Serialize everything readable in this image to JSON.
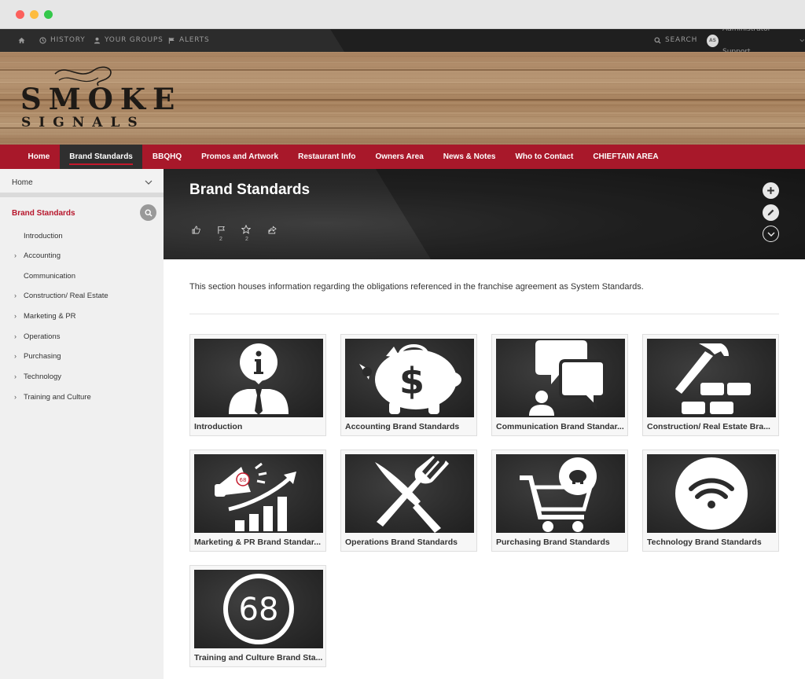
{
  "topbar": {
    "history": "HISTORY",
    "your_groups": "YOUR GROUPS",
    "alerts": "ALERTS",
    "search": "SEARCH",
    "avatar_initials": "AS",
    "user_name": "Administrator Support"
  },
  "logo": {
    "line1": "SMOKE",
    "line2": "SIGNALS"
  },
  "mainnav": [
    {
      "label": "Home"
    },
    {
      "label": "Brand Standards",
      "active": true
    },
    {
      "label": "BBQHQ"
    },
    {
      "label": "Promos and Artwork"
    },
    {
      "label": "Restaurant Info"
    },
    {
      "label": "Owners Area"
    },
    {
      "label": "News & Notes"
    },
    {
      "label": "Who to Contact"
    },
    {
      "label": "CHIEFTAIN AREA"
    }
  ],
  "sidebar": {
    "home": "Home",
    "section": "Brand Standards",
    "items": [
      {
        "label": "Introduction",
        "expandable": false
      },
      {
        "label": "Accounting",
        "expandable": true
      },
      {
        "label": "Communication",
        "expandable": false
      },
      {
        "label": "Construction/ Real Estate",
        "expandable": true
      },
      {
        "label": "Marketing & PR",
        "expandable": true
      },
      {
        "label": "Operations",
        "expandable": true
      },
      {
        "label": "Purchasing",
        "expandable": true
      },
      {
        "label": "Technology",
        "expandable": true
      },
      {
        "label": "Training and Culture",
        "expandable": true
      }
    ]
  },
  "hero": {
    "title": "Brand Standards",
    "like_count": "",
    "follow_count": "2",
    "favorite_count": "2"
  },
  "intro_text": "This section houses information regarding the obligations referenced in the franchise agreement as System Standards.",
  "cards": [
    {
      "label": "Introduction",
      "icon": "info-person-icon"
    },
    {
      "label": "Accounting Brand Standards",
      "icon": "piggy-bank-icon"
    },
    {
      "label": "Communication Brand Standar...",
      "icon": "chat-bubbles-icon"
    },
    {
      "label": "Construction/ Real Estate Bra...",
      "icon": "hammer-bricks-icon"
    },
    {
      "label": "Marketing & PR Brand Standar...",
      "icon": "megaphone-chart-icon"
    },
    {
      "label": "Operations Brand Standards",
      "icon": "knife-fork-icon"
    },
    {
      "label": "Purchasing Brand Standards",
      "icon": "shopping-cart-icon"
    },
    {
      "label": "Technology Brand Standards",
      "icon": "wifi-icon"
    },
    {
      "label": "Training and Culture Brand Sta...",
      "icon": "badge-68-icon"
    }
  ],
  "badge_text": "68",
  "colors": {
    "brand_red": "#a8182a",
    "section_red": "#b7162c",
    "dark": "#2c2c2c"
  }
}
